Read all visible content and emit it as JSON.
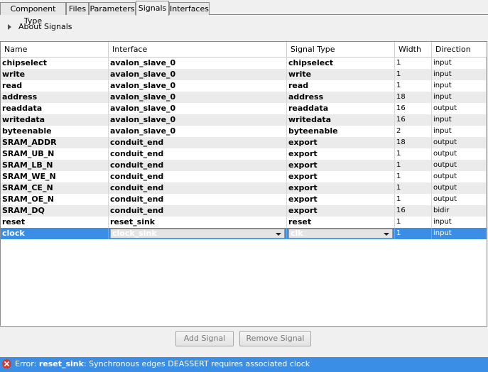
{
  "tabs": [
    "Component Type",
    "Files",
    "Parameters",
    "Signals",
    "Interfaces"
  ],
  "active_tab": "Signals",
  "about_label": "About Signals",
  "columns": [
    "Name",
    "Interface",
    "Signal Type",
    "Width",
    "Direction"
  ],
  "rows": [
    {
      "name": "chipselect",
      "interface": "avalon_slave_0",
      "type": "chipselect",
      "width": "1",
      "direction": "input"
    },
    {
      "name": "write",
      "interface": "avalon_slave_0",
      "type": "write",
      "width": "1",
      "direction": "input"
    },
    {
      "name": "read",
      "interface": "avalon_slave_0",
      "type": "read",
      "width": "1",
      "direction": "input"
    },
    {
      "name": "address",
      "interface": "avalon_slave_0",
      "type": "address",
      "width": "18",
      "direction": "input"
    },
    {
      "name": "readdata",
      "interface": "avalon_slave_0",
      "type": "readdata",
      "width": "16",
      "direction": "output"
    },
    {
      "name": "writedata",
      "interface": "avalon_slave_0",
      "type": "writedata",
      "width": "16",
      "direction": "input"
    },
    {
      "name": "byteenable",
      "interface": "avalon_slave_0",
      "type": "byteenable",
      "width": "2",
      "direction": "input"
    },
    {
      "name": "SRAM_ADDR",
      "interface": "conduit_end",
      "type": "export",
      "width": "18",
      "direction": "output"
    },
    {
      "name": "SRAM_UB_N",
      "interface": "conduit_end",
      "type": "export",
      "width": "1",
      "direction": "output"
    },
    {
      "name": "SRAM_LB_N",
      "interface": "conduit_end",
      "type": "export",
      "width": "1",
      "direction": "output"
    },
    {
      "name": "SRAM_WE_N",
      "interface": "conduit_end",
      "type": "export",
      "width": "1",
      "direction": "output"
    },
    {
      "name": "SRAM_CE_N",
      "interface": "conduit_end",
      "type": "export",
      "width": "1",
      "direction": "output"
    },
    {
      "name": "SRAM_OE_N",
      "interface": "conduit_end",
      "type": "export",
      "width": "1",
      "direction": "output"
    },
    {
      "name": "SRAM_DQ",
      "interface": "conduit_end",
      "type": "export",
      "width": "16",
      "direction": "bidir"
    },
    {
      "name": "reset",
      "interface": "reset_sink",
      "type": "reset",
      "width": "1",
      "direction": "input"
    },
    {
      "name": "clock",
      "interface": "clock_sink",
      "type": "clk",
      "width": "1",
      "direction": "input",
      "selected": true
    }
  ],
  "buttons": {
    "add": "Add Signal",
    "remove": "Remove Signal"
  },
  "status": {
    "prefix": "Error: ",
    "interface": "reset_sink",
    "message": ": Synchronous edges DEASSERT requires associated clock"
  },
  "colors": {
    "selection": "#3a8ee6",
    "error_icon": "#d83a2a"
  }
}
